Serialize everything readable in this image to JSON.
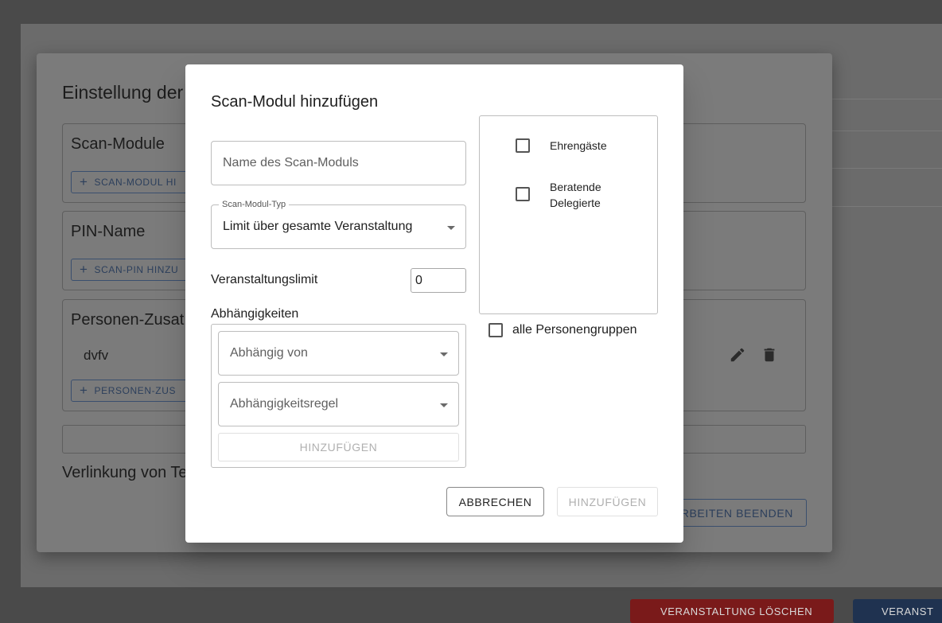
{
  "background": {
    "bottom_buttons": {
      "delete": "VERANSTALTUNG LÖSCHEN",
      "other": "VERANST"
    }
  },
  "settings_dialog": {
    "title": "Einstellung der",
    "scan_modules": {
      "title": "Scan-Module",
      "add_button": "SCAN-MODUL HI"
    },
    "pin_name": {
      "title": "PIN-Name",
      "add_button": "SCAN-PIN HINZU"
    },
    "person_extras": {
      "title": "Personen-Zusat",
      "item": "dvfv",
      "add_button": "PERSONEN-ZUS"
    },
    "linking_title": "Verlinkung von Te",
    "finish_button": "RBEITEN BEENDEN"
  },
  "add_scan_module_dialog": {
    "title": "Scan-Modul hinzufügen",
    "name_field": {
      "placeholder": "Name des Scan-Moduls",
      "value": ""
    },
    "type_field": {
      "label": "Scan-Modul-Typ",
      "value": "Limit über gesamte Veranstaltung"
    },
    "event_limit": {
      "label": "Veranstaltungslimit",
      "value": "0"
    },
    "dependencies": {
      "label": "Abhängigkeiten",
      "depends_on_placeholder": "Abhängig von",
      "rule_placeholder": "Abhängigkeitsregel",
      "add_button": "HINZUFÜGEN"
    },
    "person_groups": [
      {
        "label": "Ehrengäste",
        "checked": false
      },
      {
        "label": "Beratende Delegierte",
        "checked": false
      }
    ],
    "all_groups": {
      "label": "alle Personengruppen",
      "checked": false
    },
    "cancel_button": "ABBRECHEN",
    "submit_button": "HINZUFÜGEN"
  }
}
